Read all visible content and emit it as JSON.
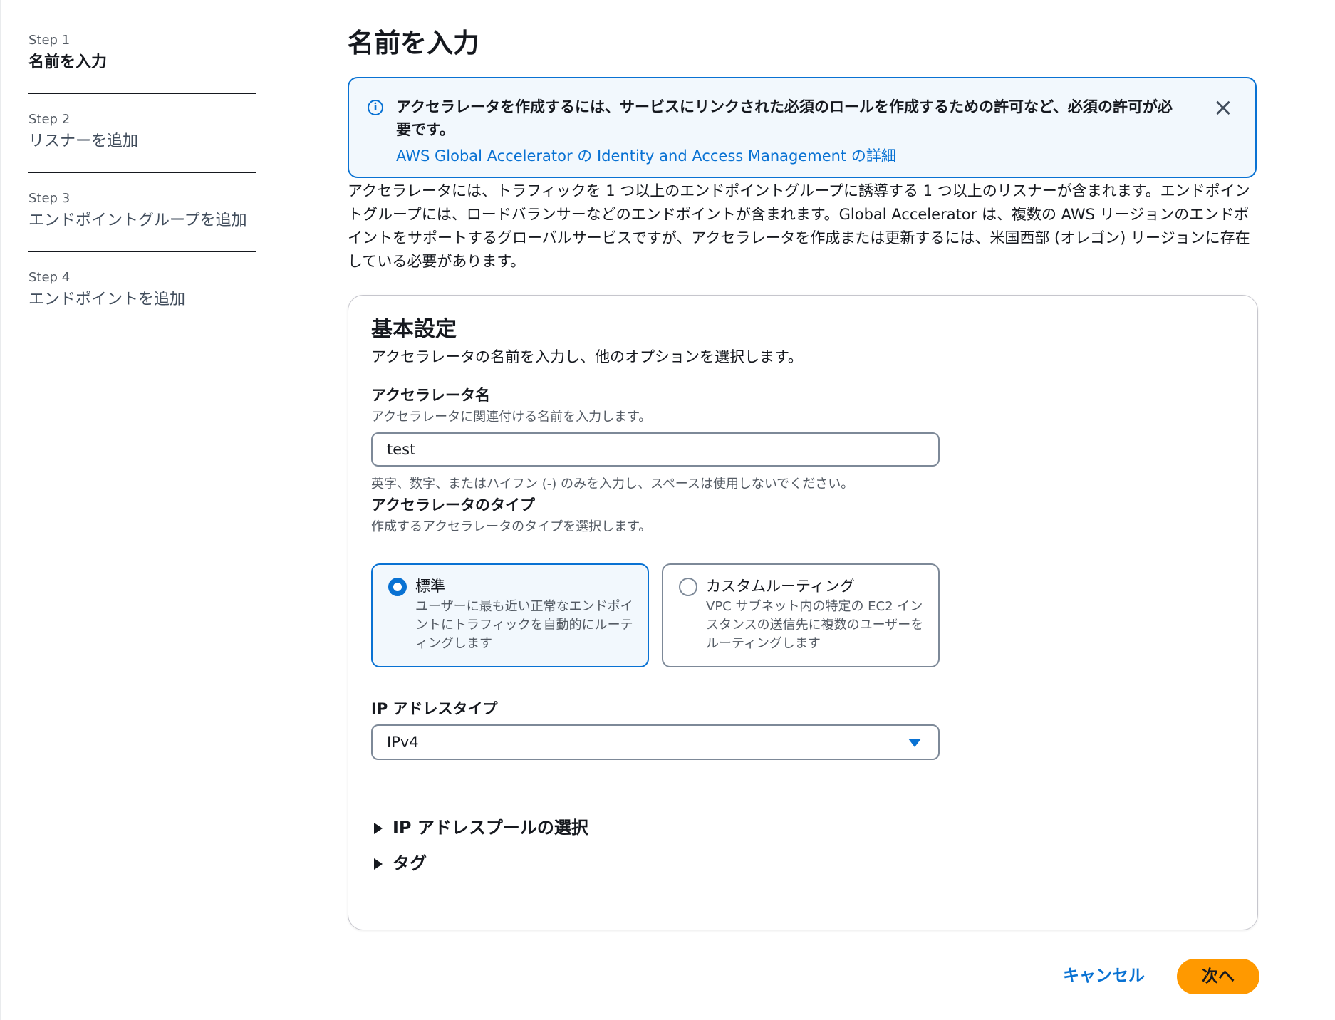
{
  "steps": [
    {
      "num": "Step 1",
      "label": "名前を入力"
    },
    {
      "num": "Step 2",
      "label": "リスナーを追加"
    },
    {
      "num": "Step 3",
      "label": "エンドポイントグループを追加"
    },
    {
      "num": "Step 4",
      "label": "エンドポイントを追加"
    }
  ],
  "page": {
    "title": "名前を入力"
  },
  "alert": {
    "icon": "info-icon",
    "text": "アクセラレータを作成するには、サービスにリンクされた必須のロールを作成するための許可など、必須の許可が必要です。",
    "link": "AWS Global Accelerator の Identity and Access Management の詳細",
    "close_icon": "close-icon"
  },
  "description": "アクセラレータには、トラフィックを 1 つ以上のエンドポイントグループに誘導する 1 つ以上のリスナーが含まれます。エンドポイントグループには、ロードバランサーなどのエンドポイントが含まれます。Global Accelerator は、複数の AWS リージョンのエンドポイントをサポートするグローバルサービスですが、アクセラレータを作成または更新するには、米国西部 (オレゴン) リージョンに存在している必要があります。",
  "basic": {
    "title": "基本設定",
    "desc": "アクセラレータの名前を入力し、他のオプションを選択します。",
    "name_field": {
      "label": "アクセラレータ名",
      "desc": "アクセラレータに関連付ける名前を入力します。",
      "value": "test",
      "constraint": "英字、数字、またはハイフン (-) のみを入力し、スペースは使用しないでください。"
    },
    "type_field": {
      "label": "アクセラレータのタイプ",
      "desc": "作成するアクセラレータのタイプを選択します。",
      "options": [
        {
          "title": "標準",
          "desc": "ユーザーに最も近い正常なエンドポイントにトラフィックを自動的にルーティングします",
          "selected": true
        },
        {
          "title": "カスタムルーティング",
          "desc": "VPC サブネット内の特定の EC2 インスタンスの送信先に複数のユーザーをルーティングします",
          "selected": false
        }
      ]
    },
    "ip_field": {
      "label": "IP アドレスタイプ",
      "value": "IPv4"
    },
    "expanders": [
      "IP アドレスプールの選択",
      "タグ"
    ]
  },
  "actions": {
    "cancel": "キャンセル",
    "next": "次へ"
  },
  "colors": {
    "accent": "#0972d3",
    "primary_button": "#ff9900",
    "alert_bg": "#f2f8fd"
  }
}
